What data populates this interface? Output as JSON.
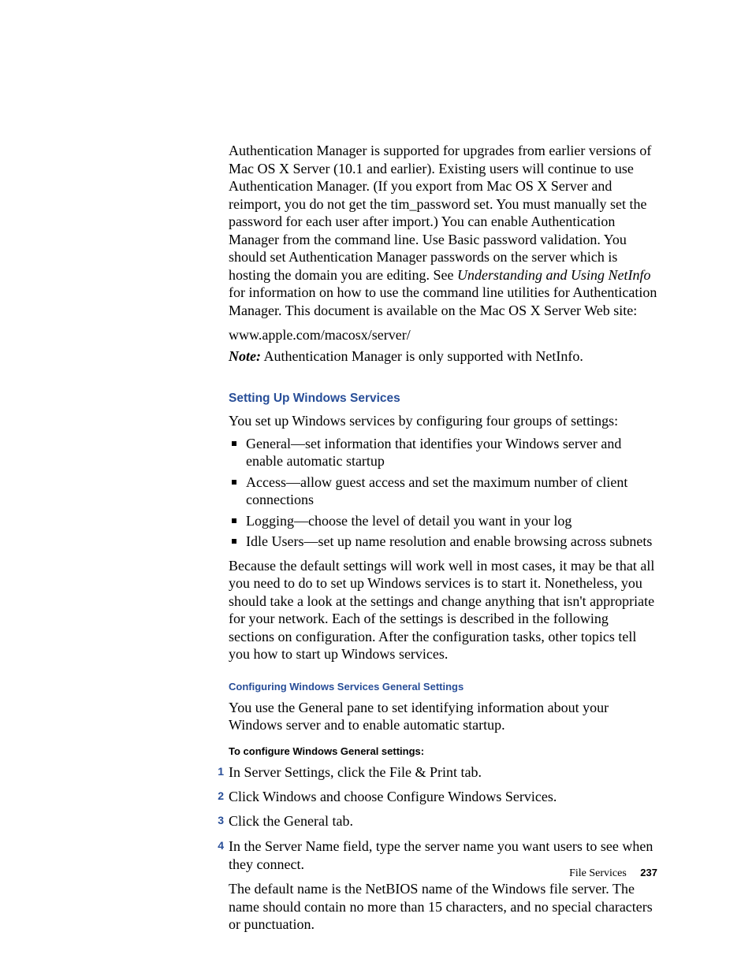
{
  "intro": {
    "para1_a": "Authentication Manager is supported for upgrades from earlier versions of Mac OS X Server (10.1 and earlier). Existing users will continue to use Authentication Manager. (If you export from Mac OS X Server and reimport, you do not get the tim_password set. You must manually set the password for each user after import.) You can enable Authentication Manager from the command line. Use Basic password validation. You should set Authentication Manager passwords on the server which is hosting the domain you are editing. See ",
    "para1_em": "Understanding and Using NetInfo",
    "para1_b": " for information on how to use the command line utilities for Authentication Manager. This document is available on the Mac OS X Server Web site:",
    "url": "www.apple.com/macosx/server/",
    "note_label": "Note:",
    "note_text": "  Authentication Manager is only supported with NetInfo."
  },
  "section1": {
    "heading": "Setting Up Windows Services",
    "lead": "You set up Windows services by configuring four groups of settings:",
    "bullets": [
      "General—set information that identifies your Windows server and enable automatic startup",
      "Access—allow guest access and set the maximum number of client connections",
      "Logging—choose the level of detail you want in your log",
      "Idle Users—set up name resolution and enable browsing across subnets"
    ],
    "tail": "Because the default settings will work well in most cases, it may be that all you need to do to set up Windows services is to start it. Nonetheless, you should take a look at the settings and change anything that isn't appropriate for your network. Each of the settings is described in the following sections on configuration. After the configuration tasks, other topics tell you how to start up Windows services."
  },
  "section2": {
    "subheading": "Configuring Windows Services General Settings",
    "lead": "You use the General pane to set identifying information about your Windows server and to enable automatic startup.",
    "task_heading": "To configure Windows General settings:",
    "steps": [
      "In Server Settings, click the File & Print tab.",
      "Click Windows and choose Configure Windows Services.",
      "Click the General tab.",
      "In the Server Name field, type the server name you want users to see when they connect."
    ],
    "step4_followup": "The default name is the NetBIOS name of the Windows file server. The name should contain no more than 15 characters, and no special characters or punctuation."
  },
  "footer": {
    "section_label": "File Services",
    "page_number": "237"
  }
}
